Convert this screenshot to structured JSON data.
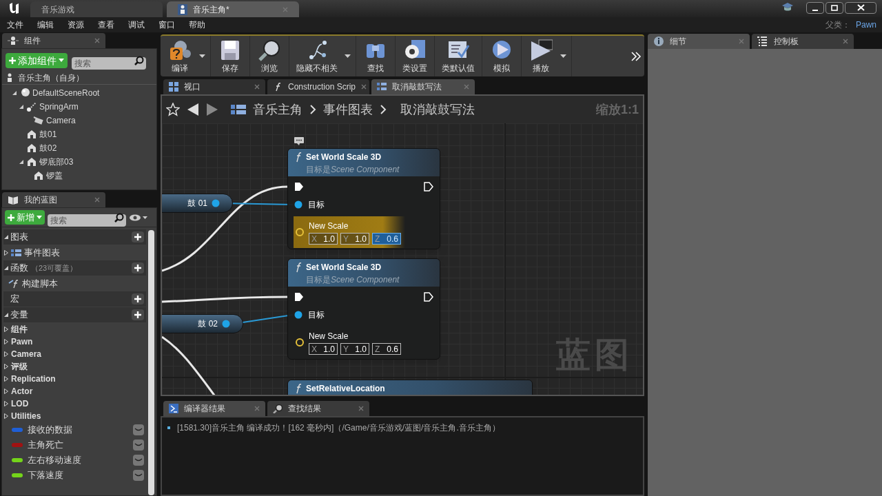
{
  "title_bar": {
    "tabs": [
      {
        "label": "音乐游戏",
        "selected": false
      },
      {
        "label": "音乐主角*",
        "selected": true
      }
    ]
  },
  "menu": [
    "文件",
    "编辑",
    "资源",
    "查看",
    "调试",
    "窗口",
    "帮助"
  ],
  "parent_class": {
    "label": "父类：",
    "value": "Pawn"
  },
  "components_panel": {
    "tab": "组件",
    "add_button": "添加组件",
    "search": {
      "placeholder": "搜索"
    },
    "self_label": "音乐主角（自身）",
    "tree": [
      {
        "label": "DefaultSceneRoot",
        "kind": "root",
        "expanded": true,
        "children": [
          {
            "label": "SpringArm",
            "kind": "arm",
            "expanded": true,
            "children": [
              {
                "label": "Camera",
                "kind": "camera"
              }
            ]
          },
          {
            "label": "鼓01",
            "kind": "mesh"
          },
          {
            "label": "鼓02",
            "kind": "mesh"
          },
          {
            "label": "锣底部03",
            "kind": "mesh",
            "expanded": true,
            "children": [
              {
                "label": "锣盖",
                "kind": "mesh"
              }
            ]
          }
        ]
      }
    ]
  },
  "my_blueprint": {
    "tab": "我的蓝图",
    "new_button": "新增",
    "search": {
      "placeholder": "搜索"
    },
    "sections": [
      {
        "label": "图表",
        "expanded": true,
        "items": [
          {
            "label": "事件图表",
            "kind": "graph",
            "expanded": false
          }
        ]
      },
      {
        "label": "函数",
        "note": "（23可覆盖）",
        "expanded": true,
        "items": [
          {
            "label": "构建脚本",
            "kind": "function"
          }
        ]
      },
      {
        "label": "宏"
      },
      {
        "label": "变量",
        "expanded": true,
        "items": [
          {
            "label": "组件",
            "kind": "category",
            "expanded": false
          },
          {
            "label": "Pawn",
            "kind": "category",
            "expanded": false
          },
          {
            "label": "Camera",
            "kind": "category",
            "expanded": false
          },
          {
            "label": "评级",
            "kind": "category",
            "expanded": false
          },
          {
            "label": "Replication",
            "kind": "category",
            "expanded": false
          },
          {
            "label": "Actor",
            "kind": "category",
            "expanded": false
          },
          {
            "label": "LOD",
            "kind": "category",
            "expanded": false
          },
          {
            "label": "Utilities",
            "kind": "category",
            "expanded": false
          },
          {
            "label": "接收的数据",
            "kind": "variable",
            "color": "#1f5fd6"
          },
          {
            "label": "主角死亡",
            "kind": "variable",
            "color": "#a01212"
          },
          {
            "label": "左右移动速度",
            "kind": "variable",
            "color": "#74d41a"
          },
          {
            "label": "下落速度",
            "kind": "variable",
            "color": "#74d41a"
          }
        ]
      }
    ]
  },
  "toolbar": {
    "buttons": [
      {
        "label": "编译",
        "kind": "compile",
        "has_dropdown": true
      },
      {
        "label": "保存",
        "kind": "save",
        "has_dropdown": false
      },
      {
        "label": "浏览",
        "kind": "browse",
        "has_dropdown": false
      },
      {
        "label": "隐藏不相关",
        "kind": "hide",
        "has_dropdown": true
      },
      {
        "label": "查找",
        "kind": "find",
        "has_dropdown": false
      },
      {
        "label": "类设置",
        "kind": "settings",
        "has_dropdown": false
      },
      {
        "label": "类默认值",
        "kind": "defaults",
        "has_dropdown": false
      },
      {
        "label": "模拟",
        "kind": "simulate",
        "has_dropdown": false
      },
      {
        "label": "播放",
        "kind": "play",
        "has_dropdown": true
      }
    ]
  },
  "doc_tabs": [
    {
      "label": "视口",
      "kind": "viewport",
      "selected": false
    },
    {
      "label": "Construction Scrip",
      "kind": "function",
      "selected": false
    },
    {
      "label": "取消敲鼓写法",
      "kind": "graph",
      "selected": true
    }
  ],
  "graph": {
    "breadcrumb": [
      "音乐主角",
      "事件图表",
      "取消敲鼓写法"
    ],
    "zoom": "缩放1:1",
    "watermark": "蓝图",
    "nodes": [
      {
        "kind": "variable",
        "label": "鼓 01"
      },
      {
        "kind": "variable",
        "label": "鼓 02"
      },
      {
        "kind": "function",
        "title": "Set World Scale 3D",
        "subtitle": {
          "prefix": "目标是",
          "target": "Scene Component"
        },
        "target_pin": "目标",
        "vector_pin": {
          "label": "New Scale",
          "highlighted": true,
          "fields": [
            {
              "axis": "X",
              "value": "1.0",
              "selected": false
            },
            {
              "axis": "Y",
              "value": "1.0",
              "selected": false
            },
            {
              "axis": "Z",
              "value": "0.6",
              "selected": true
            }
          ]
        }
      },
      {
        "kind": "function",
        "title": "Set World Scale 3D",
        "subtitle": {
          "prefix": "目标是",
          "target": "Scene Component"
        },
        "target_pin": "目标",
        "vector_pin": {
          "label": "New Scale",
          "highlighted": false,
          "fields": [
            {
              "axis": "X",
              "value": "1.0",
              "selected": false
            },
            {
              "axis": "Y",
              "value": "1.0",
              "selected": false
            },
            {
              "axis": "Z",
              "value": "0.6",
              "selected": false
            }
          ]
        }
      },
      {
        "kind": "function",
        "title": "SetRelativeLocation"
      }
    ]
  },
  "bottom_tabs": [
    {
      "label": "编译器结果",
      "kind": "compiler",
      "selected": true
    },
    {
      "label": "查找结果",
      "kind": "find",
      "selected": false
    }
  ],
  "log": [
    "[1581.30]音乐主角 编译成功！[162 毫秒内]（/Game/音乐游戏/蓝图/音乐主角.音乐主角）"
  ],
  "details_tabs": [
    {
      "label": "细节",
      "kind": "details",
      "selected": true
    },
    {
      "label": "控制板",
      "kind": "palette",
      "selected": false
    }
  ]
}
